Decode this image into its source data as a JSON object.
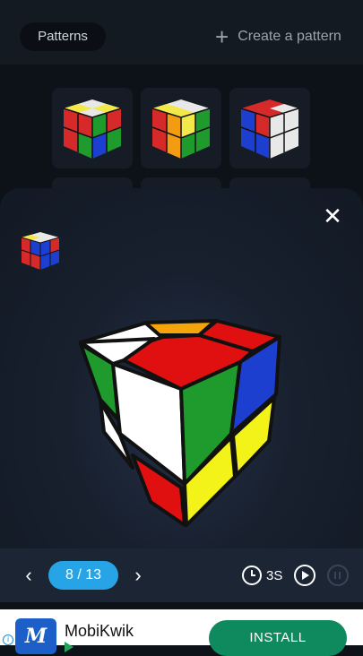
{
  "header": {
    "patterns_label": "Patterns",
    "create_label": "Create a pattern",
    "create_icon": "plus-icon"
  },
  "thumbnails": [
    {
      "name": "pattern-1"
    },
    {
      "name": "pattern-2"
    },
    {
      "name": "pattern-3"
    }
  ],
  "viewer": {
    "close_icon": "close-icon",
    "step_label": "8 / 13",
    "speed_label": "3S",
    "prev_icon": "chevron-left-icon",
    "next_icon": "chevron-right-icon",
    "clock_icon": "clock-icon",
    "play_icon": "play-icon",
    "pause_icon": "pause-icon"
  },
  "colors": {
    "accent": "#27a4e6",
    "install": "#0f8a5f"
  },
  "ad": {
    "app_name": "MobiKwik",
    "install_label": "INSTALL",
    "logo_text": "M"
  }
}
